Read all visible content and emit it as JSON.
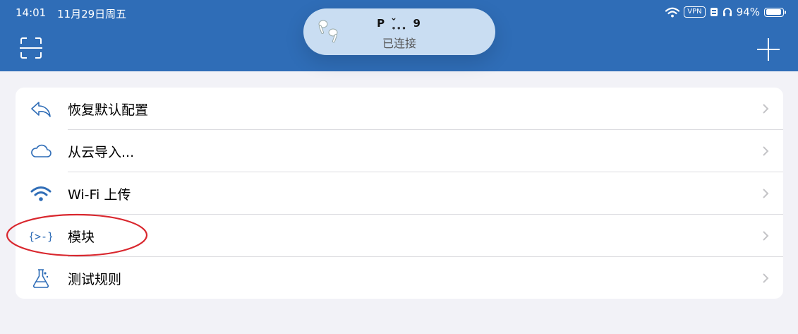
{
  "status_bar": {
    "time": "14:01",
    "date": "11月29日周五",
    "vpn": "VPN",
    "battery": "94%"
  },
  "island": {
    "device_name": "P ˇ̥ ̥ ̥ 9",
    "status": "已连接"
  },
  "menu": {
    "items": [
      {
        "label": "恢复默认配置",
        "icon": "reply-arrow-icon"
      },
      {
        "label": "从云导入...",
        "icon": "cloud-icon"
      },
      {
        "label": "Wi-Fi 上传",
        "icon": "wifi-icon"
      },
      {
        "label": "模块",
        "icon": "code-braces-icon"
      },
      {
        "label": "测试规则",
        "icon": "flask-icon"
      }
    ]
  },
  "colors": {
    "header": "#2f6db7",
    "accent": "#2f6db7",
    "background": "#f2f2f7",
    "annotation": "#d9272e"
  }
}
